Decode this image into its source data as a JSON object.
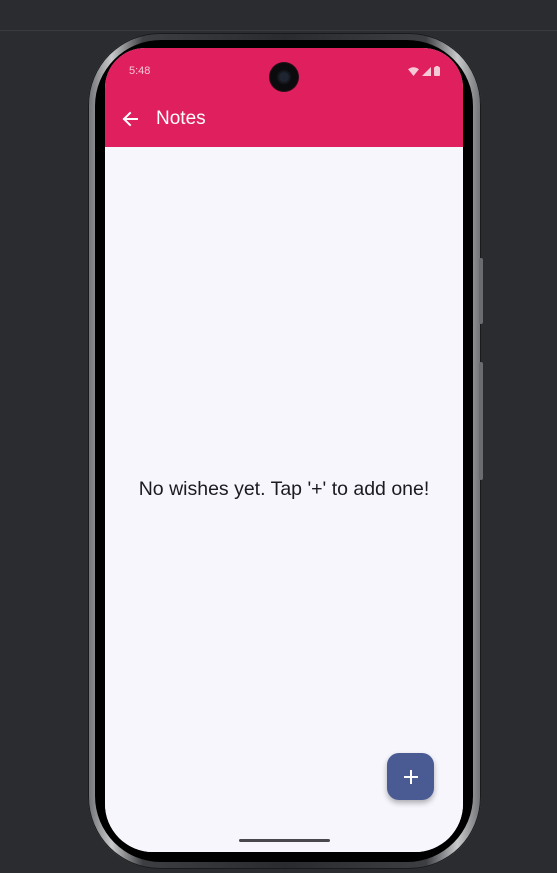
{
  "status_bar": {
    "time": "5:48",
    "icons": [
      "wifi-icon",
      "signal-icon",
      "battery-icon"
    ]
  },
  "app_bar": {
    "title": "Notes",
    "back_icon": "arrow-back-icon",
    "color": "#df1f5e"
  },
  "content": {
    "empty_message": "No wishes yet. Tap '+' to add one!"
  },
  "fab": {
    "icon": "plus-icon",
    "color": "#4a5b94"
  }
}
